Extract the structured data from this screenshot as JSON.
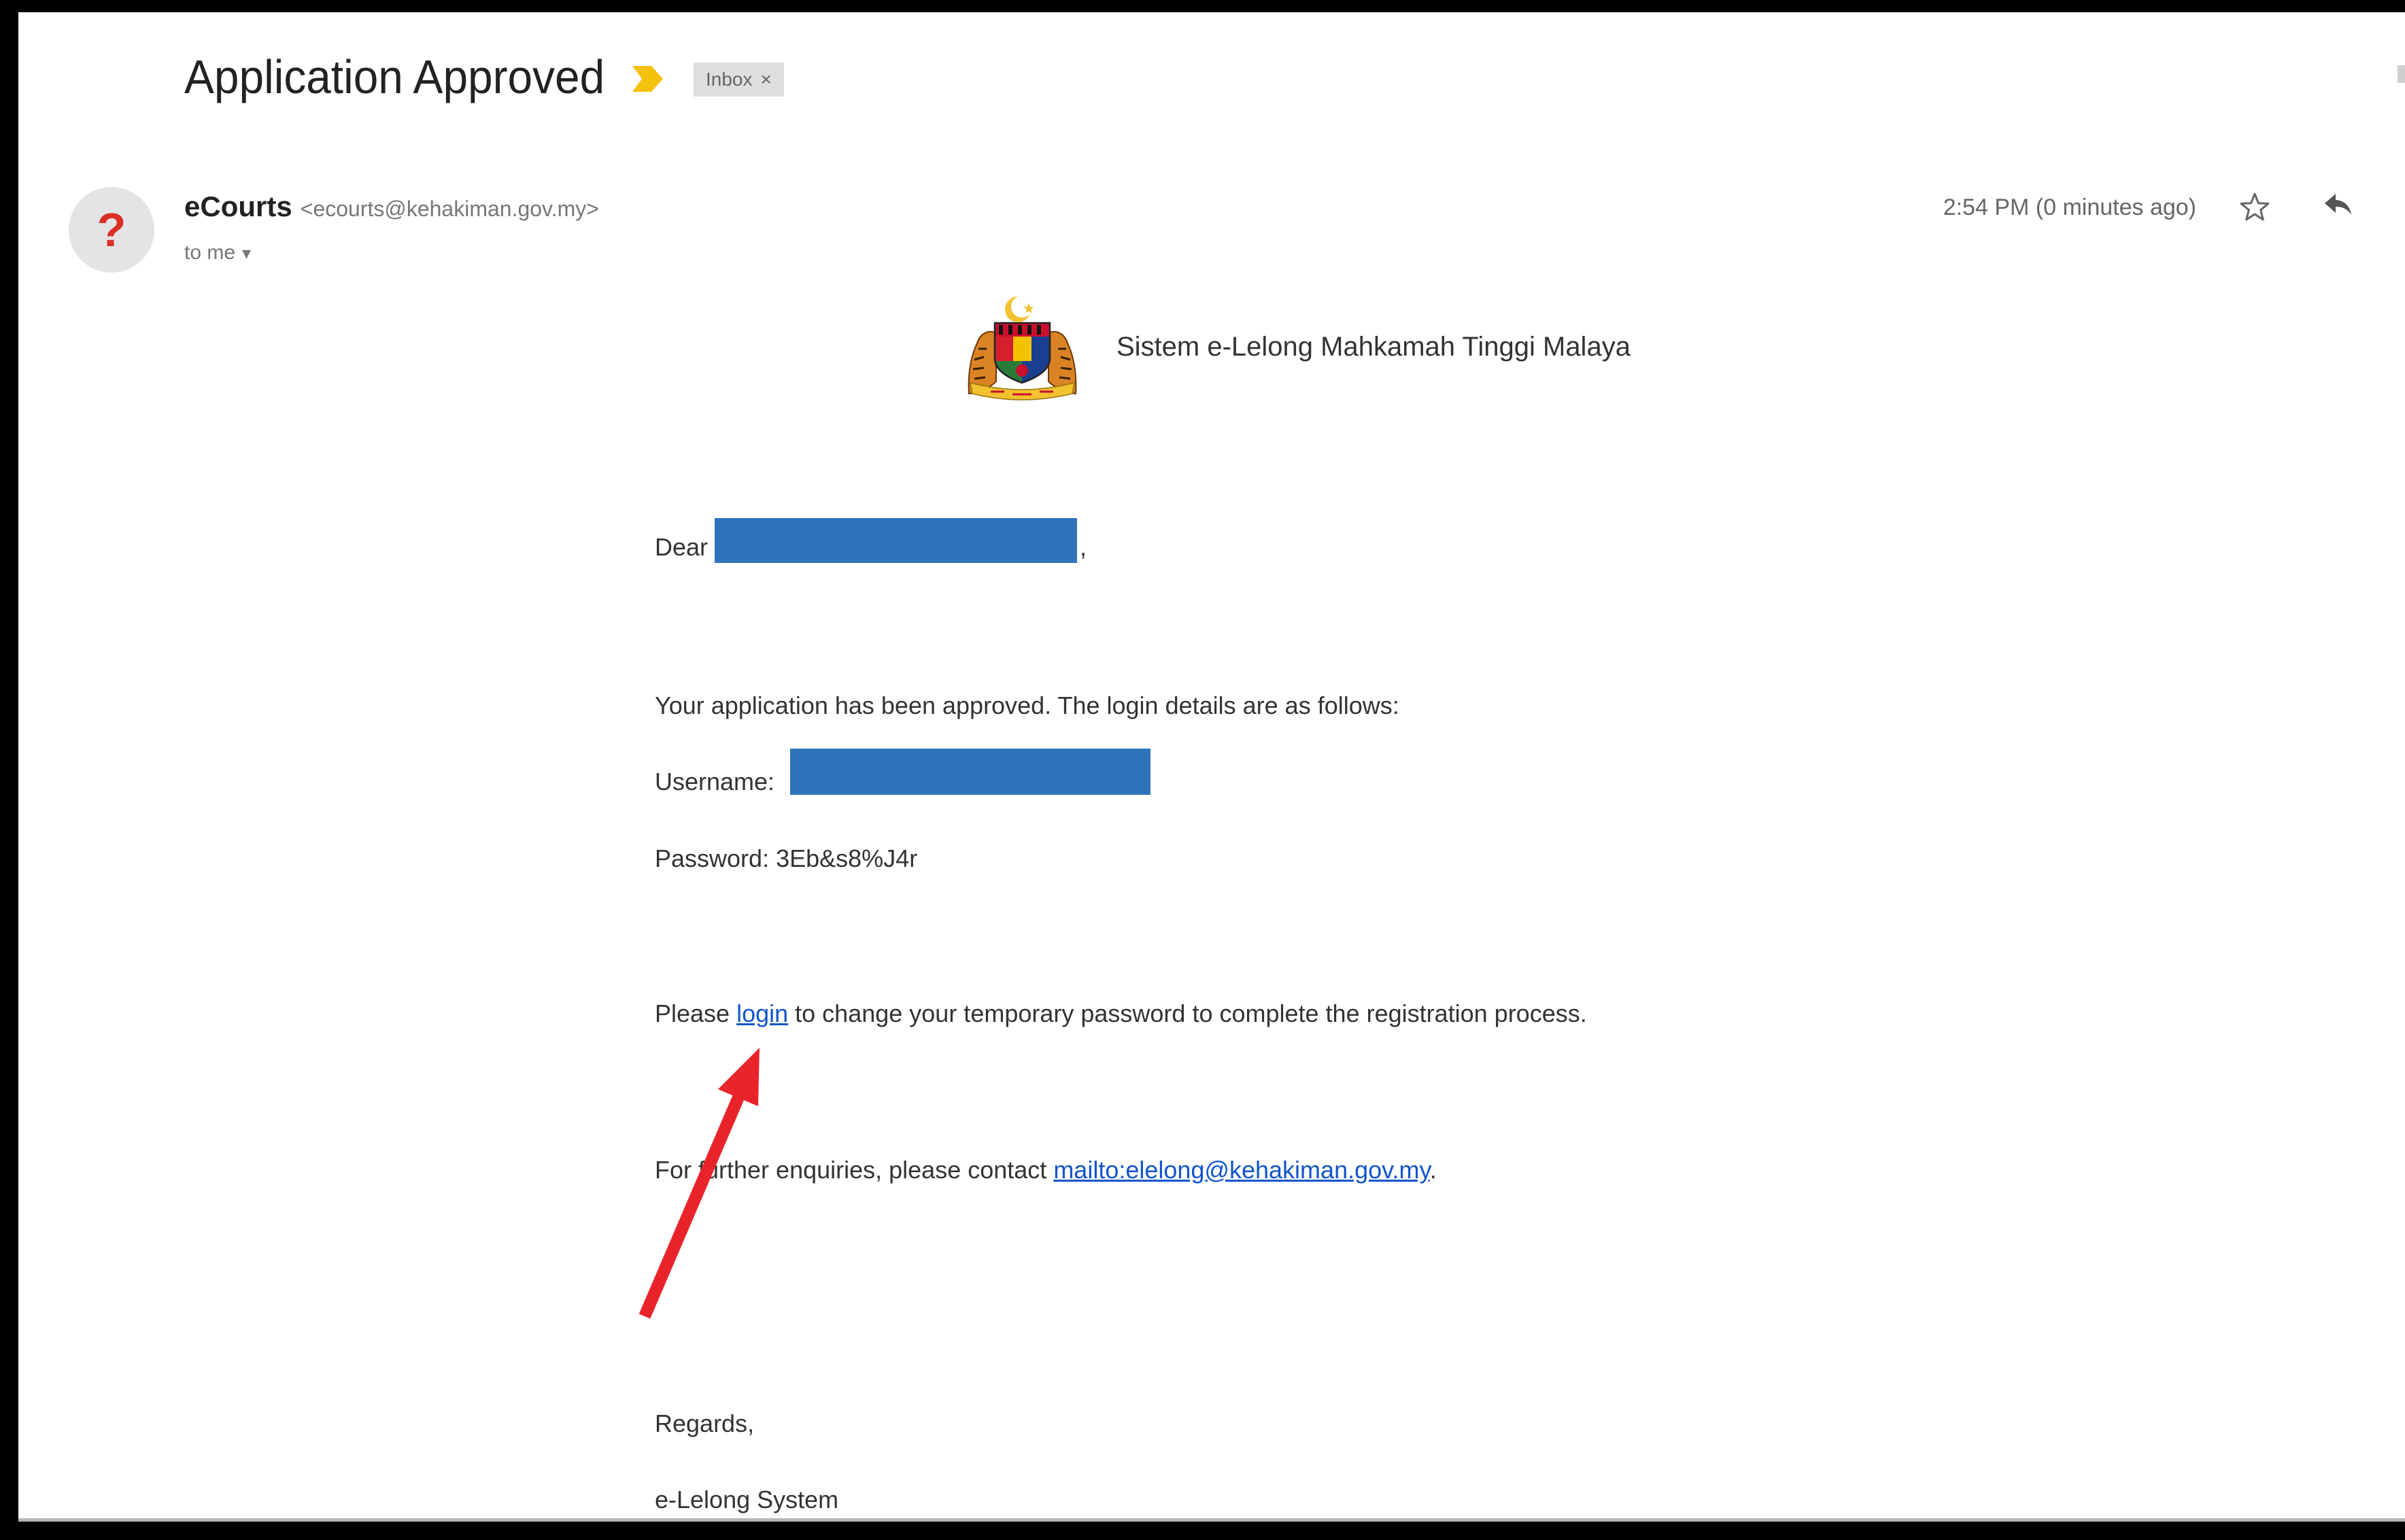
{
  "email_view": {
    "subject": "Application Approved",
    "label": {
      "name": "Inbox",
      "remove": "×"
    },
    "sender": {
      "avatar": "?",
      "name": "eCourts",
      "address": "<ecourts@kehakiman.gov.my>",
      "recipient": "to me",
      "details_toggle": "▾"
    },
    "time": "2:54 PM (0 minutes ago)"
  },
  "message": {
    "header_title": "Sistem e-Lelong Mahkamah Tinggi Malaya",
    "greeting": {
      "prefix": "Dear",
      "suffix": ","
    },
    "intro": "Your application has been approved. The login details are as follows:",
    "username_label": "Username:",
    "password_label": "Password:",
    "password_value": "3Eb&s8%J4r",
    "login_prefix": "Please ",
    "login_link": "login",
    "login_suffix": " to change your temporary password to complete the registration process.",
    "contact_prefix": "For further enquiries, please contact ",
    "contact_link": "mailto:elelong@kehakiman.gov.my",
    "contact_suffix": ".",
    "closing": "Regards,",
    "signature": "e-Lelong System"
  },
  "icons": {
    "importance": "importance-marker-icon",
    "label_remove": "close-icon",
    "details": "chevron-down-icon",
    "star": "star-icon",
    "reply": "reply-icon",
    "logo": "coat-of-arms-logo",
    "annotation": "red-arrow-annotation"
  },
  "colors": {
    "importance_marker": "#f4c20d",
    "link": "#1155cc",
    "redaction": "#2e74bb",
    "annotation_arrow": "#e8232a",
    "avatar_glyph": "#d93025"
  }
}
